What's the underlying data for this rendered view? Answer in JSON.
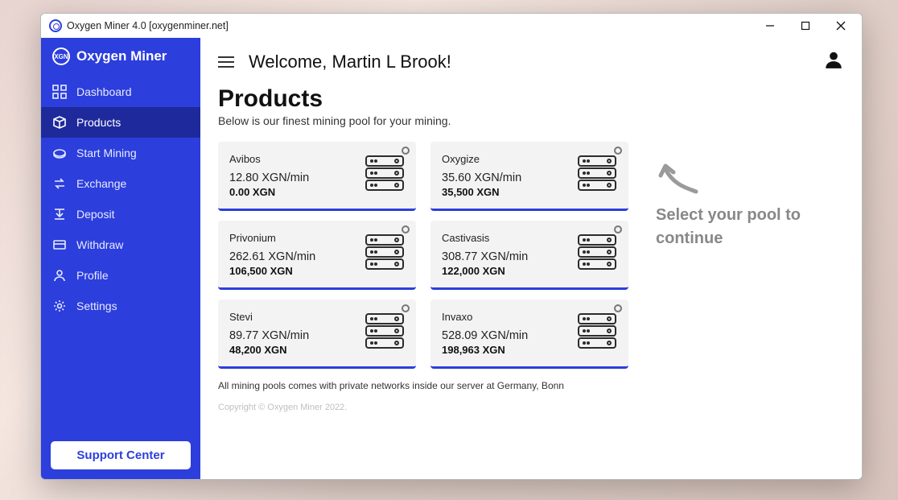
{
  "window": {
    "title": "Oxygen Miner 4.0 [oxygenminer.net]"
  },
  "brand": {
    "name": "Oxygen Miner"
  },
  "sidebar": {
    "items": [
      {
        "label": "Dashboard"
      },
      {
        "label": "Products"
      },
      {
        "label": "Start Mining"
      },
      {
        "label": "Exchange"
      },
      {
        "label": "Deposit"
      },
      {
        "label": "Withdraw"
      },
      {
        "label": "Profile"
      },
      {
        "label": "Settings"
      }
    ],
    "support_label": "Support Center"
  },
  "header": {
    "welcome": "Welcome, Martin L Brook!"
  },
  "page": {
    "title": "Products",
    "subtitle": "Below is our finest mining pool for your mining.",
    "footnote": "All mining pools comes with private networks inside our server at Germany, Bonn",
    "copyright": "Copyright © Oxygen Miner 2022."
  },
  "hint": {
    "text": "Select your pool to continue"
  },
  "pools": [
    {
      "name": "Avibos",
      "rate": "12.80 XGN/min",
      "balance": "0.00 XGN"
    },
    {
      "name": "Oxygize",
      "rate": "35.60 XGN/min",
      "balance": "35,500 XGN"
    },
    {
      "name": "Privonium",
      "rate": "262.61 XGN/min",
      "balance": "106,500 XGN"
    },
    {
      "name": "Castivasis",
      "rate": "308.77 XGN/min",
      "balance": "122,000 XGN"
    },
    {
      "name": "Stevi",
      "rate": "89.77 XGN/min",
      "balance": "48,200 XGN"
    },
    {
      "name": "Invaxo",
      "rate": "528.09 XGN/min",
      "balance": "198,963 XGN"
    }
  ]
}
